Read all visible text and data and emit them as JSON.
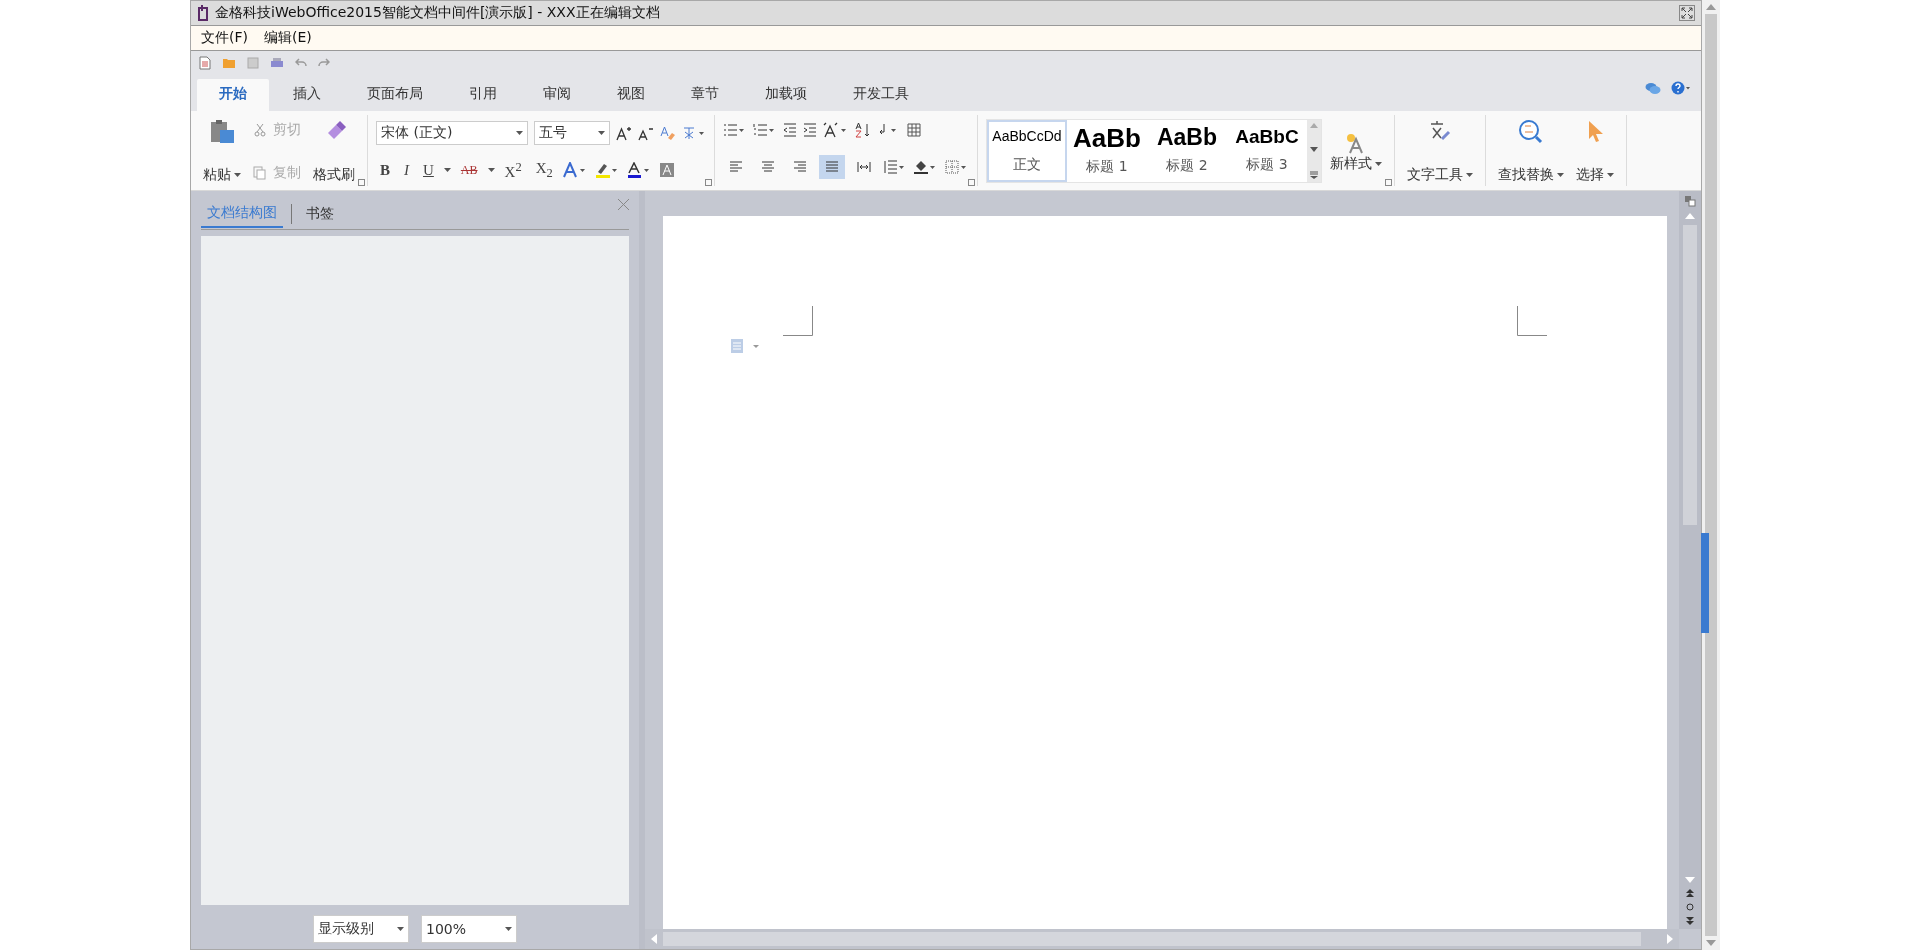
{
  "window": {
    "title": "金格科技iWebOffice2015智能文档中间件[演示版] - XXX正在编辑文档"
  },
  "menu": [
    {
      "label": "文件(F)"
    },
    {
      "label": "编辑(E)"
    }
  ],
  "tabs": [
    {
      "label": "开始",
      "selected": true
    },
    {
      "label": "插入",
      "selected": false
    },
    {
      "label": "页面布局",
      "selected": false
    },
    {
      "label": "引用",
      "selected": false
    },
    {
      "label": "审阅",
      "selected": false
    },
    {
      "label": "视图",
      "selected": false
    },
    {
      "label": "章节",
      "selected": false
    },
    {
      "label": "加载项",
      "selected": false
    },
    {
      "label": "开发工具",
      "selected": false
    }
  ],
  "clipboard": {
    "paste": "粘贴",
    "cut": {
      "label": "剪切",
      "disabled": true
    },
    "copy": {
      "label": "复制",
      "disabled": true
    },
    "format_painter": "格式刷"
  },
  "font": {
    "family": "宋体 (正文)",
    "size": "五号",
    "bold": "B",
    "italic": "I",
    "underline": "U",
    "strike": "AB",
    "superscript": "X$^{2}$",
    "subscript": "X$_{2}$"
  },
  "alignment": [
    {
      "selected": false
    },
    {
      "selected": false
    },
    {
      "selected": false
    },
    {
      "selected": true
    },
    {
      "selected": false
    }
  ],
  "styles": [
    {
      "preview": "AaBbCcDd",
      "label": "正文",
      "kind": "normal",
      "selected": true
    },
    {
      "preview": "AaBb",
      "label": "标题 1",
      "kind": "h1",
      "selected": false
    },
    {
      "preview": "AaBb",
      "label": "标题 2",
      "kind": "h2",
      "selected": false
    },
    {
      "preview": "AaBbC",
      "label": "标题 3",
      "kind": "h3",
      "selected": false
    }
  ],
  "ribbon_buttons": [
    {
      "label": "新样式",
      "kind": "new-style"
    },
    {
      "label": "文字工具",
      "kind": "text-tools"
    },
    {
      "label": "查找替换",
      "kind": "find"
    },
    {
      "label": "选择",
      "kind": "select"
    }
  ],
  "sidebar": {
    "tabs": [
      {
        "label": "文档结构图",
        "selected": true
      },
      {
        "label": "书签",
        "selected": false
      }
    ],
    "level": "显示级别",
    "zoom": "100%"
  }
}
